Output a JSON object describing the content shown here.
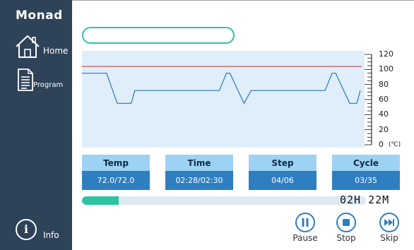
{
  "app": {
    "brand": "Monad"
  },
  "sidebar": {
    "home_label": "Home",
    "program_label": "Program",
    "info_label": "Info"
  },
  "chart_data": {
    "type": "line",
    "xlabel": "",
    "ylabel": "",
    "unit": "(℃)",
    "ylim": [
      0,
      120
    ],
    "yticks": [
      120,
      100,
      80,
      60,
      40,
      20,
      0
    ],
    "grid": false,
    "setpoint_line": {
      "value": 104,
      "color": "#c0392b"
    },
    "series": [
      {
        "color": "#2a76c0",
        "x": [
          0,
          7,
          10,
          14,
          15,
          18,
          39,
          41,
          42,
          46,
          48,
          69,
          71,
          72,
          76,
          78,
          79
        ],
        "y": [
          95,
          95,
          55,
          55,
          72,
          72,
          72,
          95,
          95,
          55,
          72,
          72,
          95,
          95,
          55,
          55,
          72
        ]
      }
    ]
  },
  "cards": [
    {
      "header": "Temp",
      "value": "72.0/72.0"
    },
    {
      "header": "Time",
      "value": "02:28/02:30"
    },
    {
      "header": "Step",
      "value": "04/06"
    },
    {
      "header": "Cycle",
      "value": "03/35"
    }
  ],
  "progress": {
    "fraction": 0.13,
    "remaining": "02H 22M"
  },
  "controls": {
    "pause_label": "Pause",
    "stop_label": "Stop",
    "skip_label": "Skip"
  },
  "colors": {
    "sidebar": "#2e4358",
    "accent": "#2ec4a0",
    "card_value": "#2f7ec0",
    "card_header": "#9dd2f3",
    "chart_bg": "#dfeef9"
  }
}
